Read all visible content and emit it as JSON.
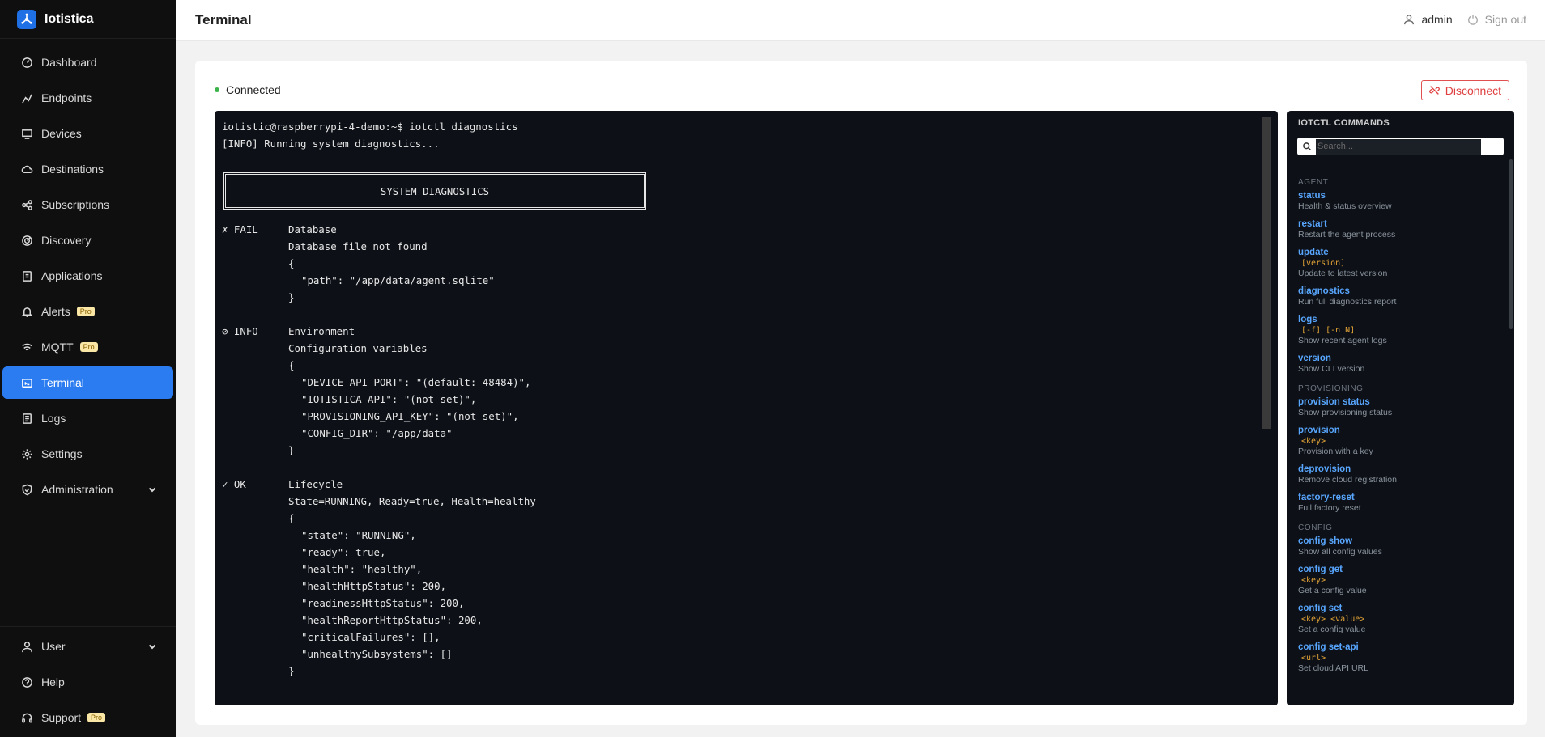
{
  "app": {
    "name": "Iotistica",
    "brand_color": "#1f6fe5",
    "accent_color": "#2b7cf0"
  },
  "sidebar": {
    "items": [
      {
        "label": "Dashboard",
        "icon": "dashboard-icon"
      },
      {
        "label": "Endpoints",
        "icon": "endpoints-icon"
      },
      {
        "label": "Devices",
        "icon": "devices-icon"
      },
      {
        "label": "Destinations",
        "icon": "cloud-icon"
      },
      {
        "label": "Subscriptions",
        "icon": "share-icon"
      },
      {
        "label": "Discovery",
        "icon": "radar-icon"
      },
      {
        "label": "Applications",
        "icon": "applications-icon"
      },
      {
        "label": "Alerts",
        "icon": "bell-icon",
        "badge": "Pro"
      },
      {
        "label": "MQTT",
        "icon": "wifi-icon",
        "badge": "Pro"
      },
      {
        "label": "Terminal",
        "icon": "terminal-icon",
        "active": true
      },
      {
        "label": "Logs",
        "icon": "logs-icon"
      },
      {
        "label": "Settings",
        "icon": "gear-icon"
      },
      {
        "label": "Administration",
        "icon": "shield-icon",
        "expandable": true
      }
    ],
    "bottom": [
      {
        "label": "User",
        "icon": "user-icon",
        "expandable": true
      },
      {
        "label": "Help",
        "icon": "help-icon"
      },
      {
        "label": "Support",
        "icon": "headset-icon",
        "badge": "Pro"
      }
    ]
  },
  "header": {
    "title": "Terminal",
    "user": "admin",
    "signout": "Sign out"
  },
  "connection": {
    "status": "Connected",
    "status_color": "#3ab34a",
    "disconnect_label": "Disconnect"
  },
  "terminal": {
    "prompt": "iotistic@raspberrypi-4-demo:~$ iotctl diagnostics",
    "info": "[INFO] Running system diagnostics...",
    "box_title": "SYSTEM DIAGNOSTICS",
    "checks": [
      {
        "status": "✗ FAIL",
        "icon": "x-icon",
        "name": "Database",
        "message": "Database file not found",
        "open": "{",
        "json": [
          "\"path\": \"/app/data/agent.sqlite\""
        ],
        "close": "}"
      },
      {
        "status": "⊘ INFO",
        "icon": "info-icon",
        "name": "Environment",
        "message": "Configuration variables",
        "open": "{",
        "json": [
          "\"DEVICE_API_PORT\": \"(default: 48484)\",",
          "\"IOTISTICA_API\": \"(not set)\",",
          "\"PROVISIONING_API_KEY\": \"(not set)\",",
          "\"CONFIG_DIR\": \"/app/data\""
        ],
        "close": "}"
      },
      {
        "status": "✓ OK",
        "icon": "check-icon",
        "name": "Lifecycle",
        "message": "State=RUNNING, Ready=true, Health=healthy",
        "open": "{",
        "json": [
          "\"state\": \"RUNNING\",",
          "\"ready\": true,",
          "\"health\": \"healthy\",",
          "\"healthHttpStatus\": 200,",
          "\"readinessHttpStatus\": 200,",
          "\"healthReportHttpStatus\": 200,",
          "\"criticalFailures\": [],",
          "\"unhealthySubsystems\": []"
        ],
        "close": "}"
      }
    ]
  },
  "commands": {
    "title": "IOTCTL COMMANDS",
    "search_placeholder": "Search...",
    "sections": [
      {
        "name": "AGENT",
        "items": [
          {
            "name": "status",
            "desc": "Health & status overview"
          },
          {
            "name": "restart",
            "desc": "Restart the agent process"
          },
          {
            "name": "update",
            "args": "[version]",
            "desc": "Update to latest version"
          },
          {
            "name": "diagnostics",
            "desc": "Run full diagnostics report"
          },
          {
            "name": "logs",
            "args": "[-f] [-n N]",
            "desc": "Show recent agent logs"
          },
          {
            "name": "version",
            "desc": "Show CLI version"
          }
        ]
      },
      {
        "name": "PROVISIONING",
        "items": [
          {
            "name": "provision status",
            "desc": "Show provisioning status"
          },
          {
            "name": "provision",
            "args": "<key>",
            "desc": "Provision with a key"
          },
          {
            "name": "deprovision",
            "desc": "Remove cloud registration"
          },
          {
            "name": "factory-reset",
            "desc": "Full factory reset"
          }
        ]
      },
      {
        "name": "CONFIG",
        "items": [
          {
            "name": "config show",
            "desc": "Show all config values"
          },
          {
            "name": "config get",
            "args": "<key>",
            "desc": "Get a config value"
          },
          {
            "name": "config set",
            "args": "<key> <value>",
            "desc": "Set a config value"
          },
          {
            "name": "config set-api",
            "args": "<url>",
            "desc": "Set cloud API URL"
          }
        ]
      }
    ]
  }
}
